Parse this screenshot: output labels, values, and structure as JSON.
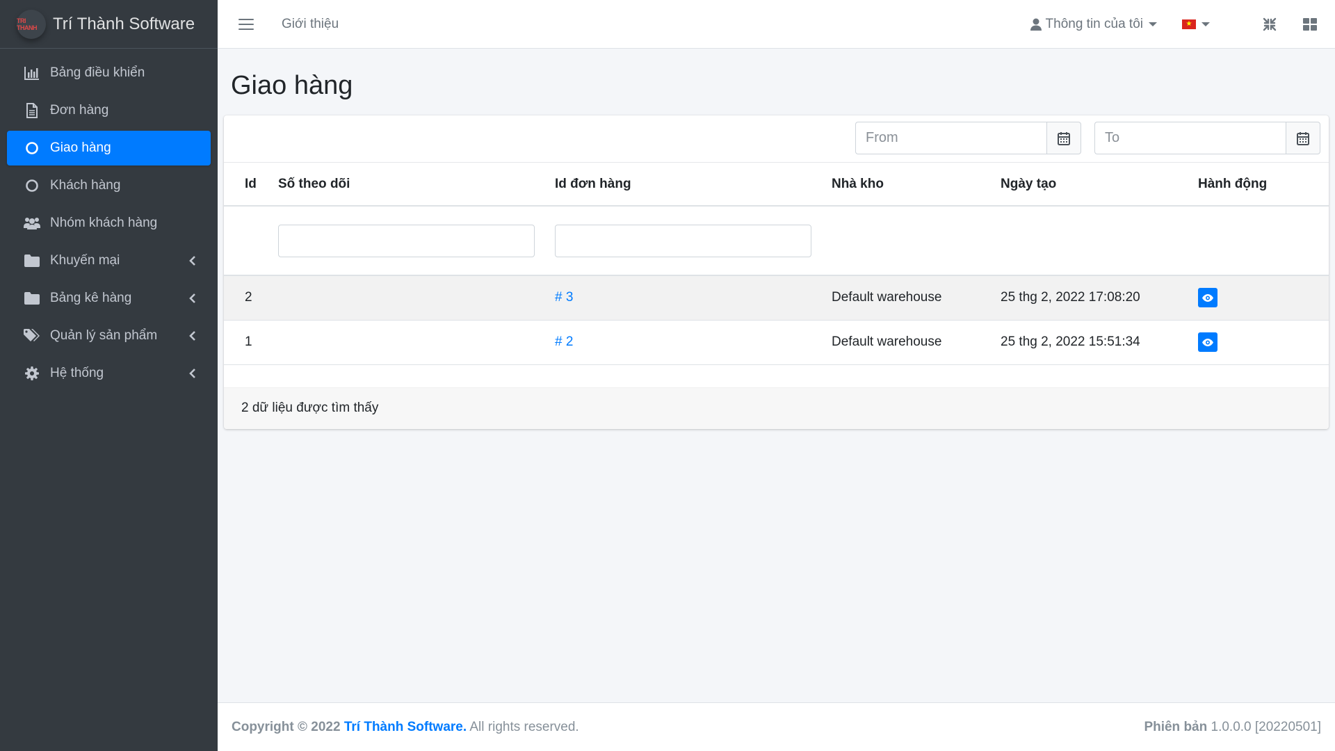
{
  "brand": {
    "name": "Trí Thành Software",
    "logo_text": "TRI THANH"
  },
  "sidebar": {
    "items": [
      {
        "label": "Bảng điều khiển",
        "icon": "chart-bar-icon"
      },
      {
        "label": "Đơn hàng",
        "icon": "file-alt-icon"
      },
      {
        "label": "Giao hàng",
        "icon": "circle-icon",
        "active": true
      },
      {
        "label": "Khách hàng",
        "icon": "circle-icon"
      },
      {
        "label": "Nhóm khách hàng",
        "icon": "users-icon"
      },
      {
        "label": "Khuyến mại",
        "icon": "folder-icon"
      },
      {
        "label": "Bảng kê hàng",
        "icon": "folder-icon"
      },
      {
        "label": "Quản lý sản phẩm",
        "icon": "tags-icon"
      },
      {
        "label": "Hệ thống",
        "icon": "cog-icon"
      }
    ]
  },
  "topbar": {
    "intro_link": "Giới thiệu",
    "user_menu": "Thông tin của tôi"
  },
  "page": {
    "title": "Giao hàng"
  },
  "filters": {
    "from_placeholder": "From",
    "to_placeholder": "To"
  },
  "table": {
    "headers": {
      "id": "Id",
      "tracking": "Số theo dõi",
      "order_id": "Id đơn hàng",
      "warehouse": "Nhà kho",
      "created": "Ngày tạo",
      "actions": "Hành động"
    },
    "rows": [
      {
        "id": "2",
        "tracking": "",
        "order_id": "# 3",
        "warehouse": "Default warehouse",
        "created": "25 thg 2, 2022 17:08:20"
      },
      {
        "id": "1",
        "tracking": "",
        "order_id": "# 2",
        "warehouse": "Default warehouse",
        "created": "25 thg 2, 2022 15:51:34"
      }
    ],
    "summary": "2 dữ liệu được tìm thấy"
  },
  "footer": {
    "copyright_prefix": "Copyright © 2022",
    "brand": "Trí Thành Software.",
    "rights": "All rights reserved.",
    "version_label": "Phiên bản",
    "version_value": "1.0.0.0 [20220501]"
  },
  "colors": {
    "accent": "#007bff",
    "sidebar_bg": "#343a40",
    "flag_red": "#da251d"
  }
}
